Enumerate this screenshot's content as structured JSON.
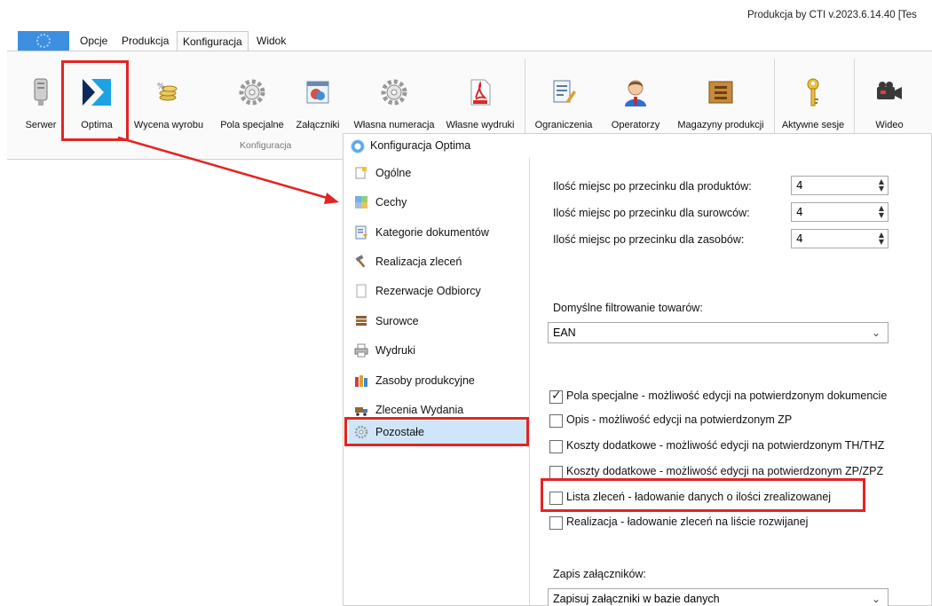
{
  "window": {
    "title": "Produkcja by CTI v.2023.6.14.40 [Tes"
  },
  "menu_tabs": [
    {
      "label": "Opcje"
    },
    {
      "label": "Produkcja"
    },
    {
      "label": "Konfiguracja"
    },
    {
      "label": "Widok"
    }
  ],
  "ribbon": {
    "buttons": [
      {
        "label": "Serwer"
      },
      {
        "label": "Optima"
      },
      {
        "label": "Wycena wyrobu"
      },
      {
        "label": "Pola specjalne"
      },
      {
        "label": "Załączniki"
      },
      {
        "label": "Własna numeracja"
      },
      {
        "label": "Własne wydruki"
      },
      {
        "label": "Ograniczenia"
      },
      {
        "label": "Operatorzy"
      },
      {
        "label": "Magazyny produkcji"
      },
      {
        "label": "Aktywne sesje"
      },
      {
        "label": "Wideo"
      }
    ],
    "group_label": "Konfiguracja"
  },
  "dialog": {
    "title": "Konfiguracja Optima",
    "nav": [
      {
        "label": "Ogólne"
      },
      {
        "label": "Cechy"
      },
      {
        "label": "Kategorie dokumentów"
      },
      {
        "label": "Realizacja zleceń"
      },
      {
        "label": "Rezerwacje Odbiorcy"
      },
      {
        "label": "Surowce"
      },
      {
        "label": "Wydruki"
      },
      {
        "label": "Zasoby produkcyjne"
      },
      {
        "label": "Zlecenia Wydania"
      },
      {
        "label": "Pozostałe"
      }
    ],
    "selected_nav": "Pozostałe",
    "decimals": [
      {
        "label": "Ilość miejsc po przecinku dla produktów:",
        "value": "4"
      },
      {
        "label": "Ilość miejsc po przecinku dla surowców:",
        "value": "4"
      },
      {
        "label": "Ilość miejsc po przecinku dla zasobów:",
        "value": "4"
      }
    ],
    "filter": {
      "label": "Domyślne filtrowanie towarów:",
      "value": "EAN"
    },
    "checkboxes": [
      {
        "label": "Pola specjalne - możliwość edycji na potwierdzonym dokumencie",
        "checked": true
      },
      {
        "label": "Opis - możliwość edycji na potwierdzonym ZP",
        "checked": false
      },
      {
        "label": "Koszty dodatkowe - możliwość edycji na potwierdzonym TH/THZ",
        "checked": false
      },
      {
        "label": "Koszty dodatkowe - możliwość edycji na potwierdzonym ZP/ZPZ",
        "checked": false
      },
      {
        "label": "Lista zleceń - ładowanie danych o ilości zrealizowanej",
        "checked": false
      },
      {
        "label": "Realizacja - ładowanie zleceń na liście rozwijanej",
        "checked": false
      }
    ],
    "attachments": {
      "label": "Zapis załączników:",
      "value": "Zapisuj załączniki w bazie danych"
    }
  },
  "colors": {
    "highlight_red": "#e32424",
    "selection_blue": "#cfe6fa",
    "app_button_blue": "#3d8fe0"
  }
}
